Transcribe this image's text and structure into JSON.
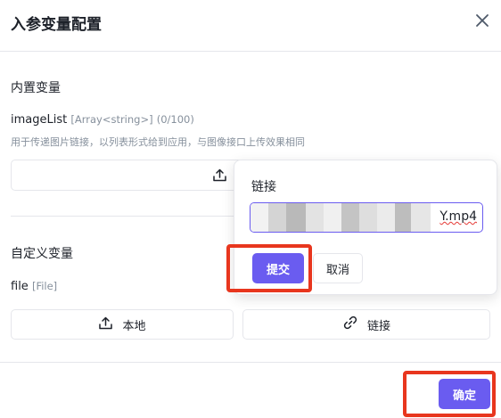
{
  "dialog": {
    "title": "入参变量配置"
  },
  "builtin": {
    "section_title": "内置变量",
    "var_name": "imageList",
    "var_type": "[Array<string>]",
    "var_count": "(0/100)",
    "description": "用于传递图片链接，以列表形式给到应用，与图像接口上传效果相同"
  },
  "custom": {
    "section_title": "自定义变量",
    "var_name": "file",
    "var_type": "[File]",
    "local_button": "本地",
    "link_button": "链接"
  },
  "popover": {
    "label": "链接",
    "input_value_visible": "Y.mp4",
    "submit_button": "提交",
    "cancel_button": "取消"
  },
  "footer": {
    "confirm_button": "确定"
  },
  "colors": {
    "primary": "#6a5cf0",
    "highlight": "#e8361e",
    "border": "#e5e6eb",
    "muted_text": "#86909c"
  },
  "icons": [
    "close-icon",
    "upload-icon",
    "link-icon"
  ]
}
